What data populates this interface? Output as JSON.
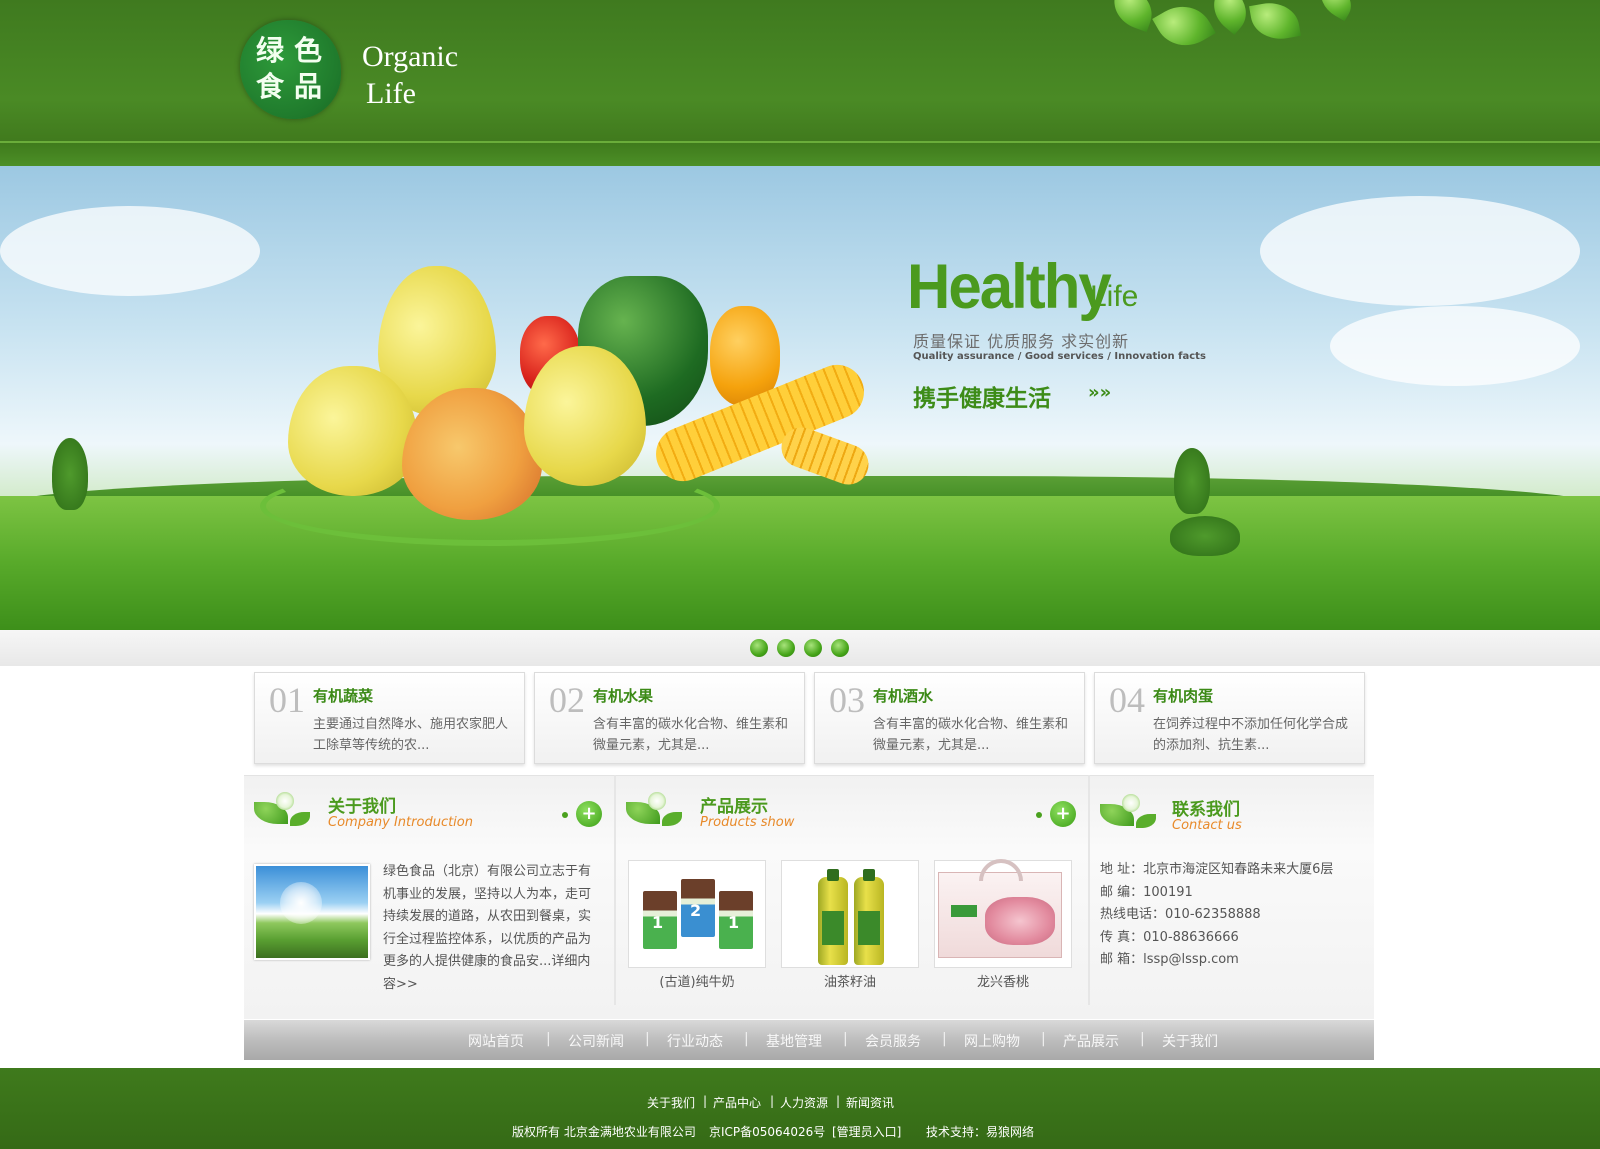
{
  "colors": {
    "header_green": "#3f7a1f",
    "accent_green": "#4b9a1e",
    "subtitle_orange": "#e88a2a",
    "navbar_gray": "#bdbdbd"
  },
  "header": {
    "logo_chars": [
      "绿",
      "色",
      "食",
      "品"
    ],
    "brand_line1": "Organic",
    "brand_line2": "Life"
  },
  "banner": {
    "headline": "Healthy",
    "headline_suffix": "Life",
    "slogan_cn": "质量保证 优质服务 求实创新",
    "slogan_en": "Quality assurance / Good services / Innovation facts",
    "cta": "携手健康生活",
    "cta_arrow": "»»",
    "active_slide": 1,
    "slide_count": 4
  },
  "features": [
    {
      "num": "01",
      "title": "有机蔬菜",
      "desc": "主要通过自然降水、施用农家肥人工除草等传统的农..."
    },
    {
      "num": "02",
      "title": "有机水果",
      "desc": "含有丰富的碳水化合物、维生素和微量元素，尤其是..."
    },
    {
      "num": "03",
      "title": "有机酒水",
      "desc": "含有丰富的碳水化合物、维生素和微量元素，尤其是..."
    },
    {
      "num": "04",
      "title": "有机肉蛋",
      "desc": "在饲养过程中不添加任何化学合成的添加剂、抗生素..."
    }
  ],
  "about": {
    "title": "关于我们",
    "subtitle": "Company Introduction",
    "text": "绿色食品（北京）有限公司立志于有机事业的发展，坚持以人为本，走可持续发展的道路，从农田到餐桌，实行全过程监控体系，以优质的产品为更多的人提供健康的食品安...详细内容>>",
    "more_icon": "plus-icon"
  },
  "products": {
    "title": "产品展示",
    "subtitle": "Products show",
    "items": [
      {
        "label": "(古道)纯牛奶"
      },
      {
        "label": "油茶籽油"
      },
      {
        "label": "龙兴香桃"
      }
    ]
  },
  "contact": {
    "title": "联系我们",
    "subtitle": "Contact us",
    "address": "地  址：北京市海淀区知春路未来大厦6层",
    "postcode": "邮  编：100191",
    "hotline": "热线电话：010-62358888",
    "fax": "传  真：010-88636666",
    "email": "邮  箱：lssp@lssp.com"
  },
  "nav": [
    "网站首页",
    "公司新闻",
    "行业动态",
    "基地管理",
    "会员服务",
    "网上购物",
    "产品展示",
    "关于我们"
  ],
  "footer": {
    "links": [
      "关于我们",
      "产品中心",
      "人力资源",
      "新闻资讯"
    ],
    "copyright": "版权所有  北京金满地农业有限公司",
    "icp": "京ICP备05064026号",
    "admin": "[管理员入口]",
    "support": "技术支持：易狼网络"
  }
}
